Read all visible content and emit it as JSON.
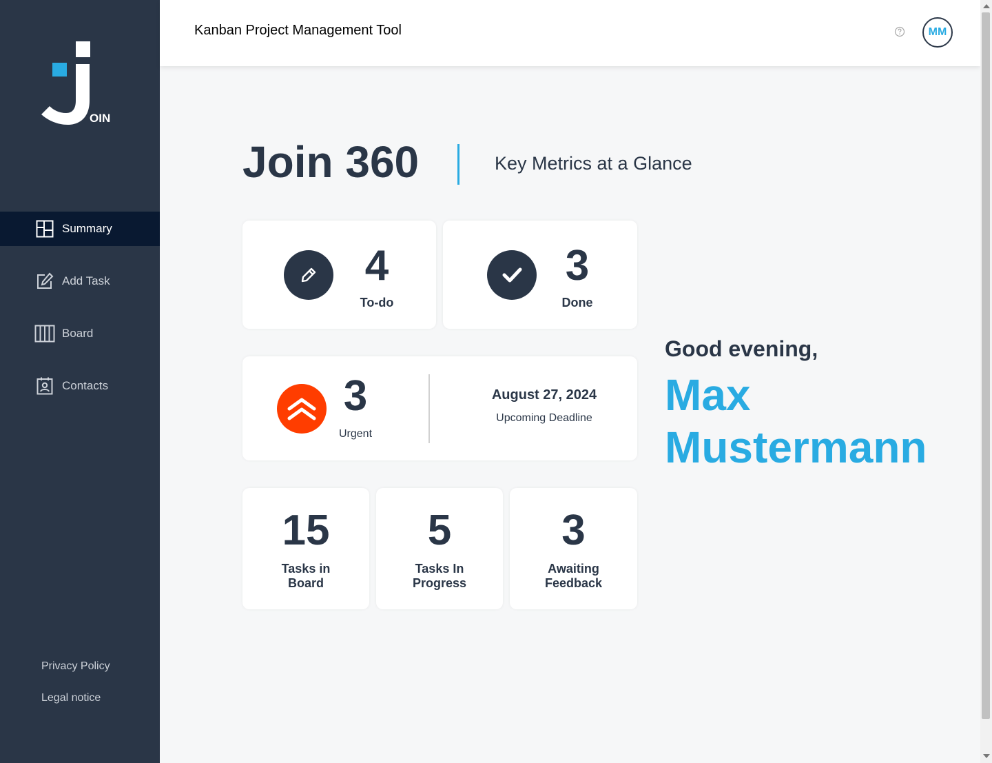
{
  "sidebar": {
    "logo_text": "OIN",
    "items": [
      {
        "label": "Summary",
        "icon": "summary-icon"
      },
      {
        "label": "Add Task",
        "icon": "edit-square-icon"
      },
      {
        "label": "Board",
        "icon": "board-icon"
      },
      {
        "label": "Contacts",
        "icon": "contacts-icon"
      }
    ],
    "footer": [
      "Privacy Policy",
      "Legal notice"
    ]
  },
  "header": {
    "title": "Kanban Project Management Tool",
    "help_icon": "help-icon",
    "avatar_initials": "MM"
  },
  "page": {
    "title": "Join 360",
    "subtitle": "Key Metrics at a Glance"
  },
  "metrics": {
    "todo": {
      "value": "4",
      "label": "To-do"
    },
    "done": {
      "value": "3",
      "label": "Done"
    },
    "urgent": {
      "value": "3",
      "label": "Urgent"
    },
    "deadline": {
      "date": "August 27, 2024",
      "label": "Upcoming Deadline"
    },
    "board": {
      "value": "15",
      "line1": "Tasks in",
      "line2": "Board"
    },
    "progress": {
      "value": "5",
      "line1": "Tasks In",
      "line2": "Progress"
    },
    "feedback": {
      "value": "3",
      "line1": "Awaiting",
      "line2": "Feedback"
    }
  },
  "greeting": {
    "text": "Good evening,",
    "first_name": "Max",
    "last_name": "Mustermann"
  },
  "colors": {
    "sidebar": "#2a3647",
    "active": "#091931",
    "accent": "#29abe2",
    "urgent": "#ff3d00"
  }
}
